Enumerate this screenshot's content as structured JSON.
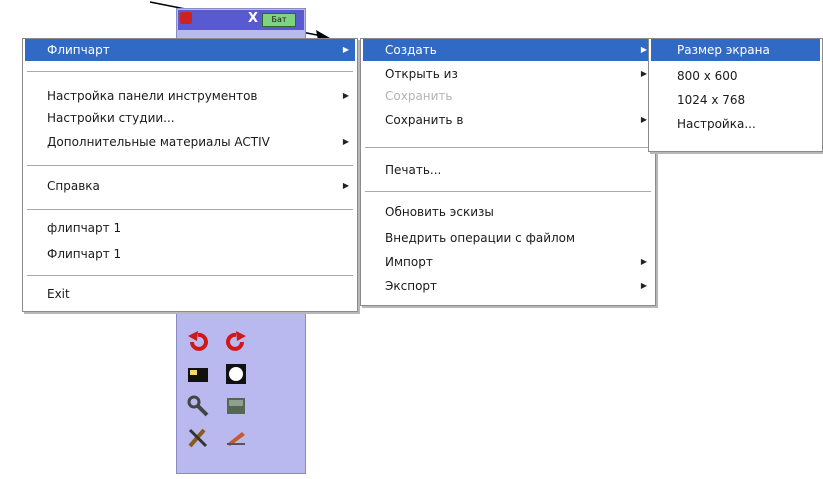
{
  "toolbar": {
    "close_label": "X",
    "mini_label": "Бат",
    "tools": [
      {
        "icon": "undo-icon"
      },
      {
        "icon": "redo-icon"
      },
      {
        "icon": "camera-icon"
      },
      {
        "icon": "spotlight-icon"
      },
      {
        "icon": "wrench-icon"
      },
      {
        "icon": "screen-shade-icon"
      },
      {
        "icon": "tools-icon"
      },
      {
        "icon": "pen-icon"
      }
    ]
  },
  "main_menu": {
    "items": [
      {
        "label": "Флипчарт"
      },
      {
        "label": "Настройка панели инструментов"
      },
      {
        "label": "Настройки студии..."
      },
      {
        "label": "Дополнительные материалы ACTIV"
      },
      {
        "label": "Справка"
      },
      {
        "label": "флипчарт 1"
      },
      {
        "label": "Флипчарт 1"
      },
      {
        "label": "Exit"
      }
    ]
  },
  "flipchart_menu": {
    "items": [
      {
        "label": "Создать"
      },
      {
        "label": "Открыть из"
      },
      {
        "label": "Сохранить"
      },
      {
        "label": "Сохранить в"
      },
      {
        "label": "Печать..."
      },
      {
        "label": "Обновить эскизы"
      },
      {
        "label": "Внедрить операции с файлом"
      },
      {
        "label": "Импорт"
      },
      {
        "label": "Экспорт"
      }
    ]
  },
  "create_menu": {
    "items": [
      {
        "label": "Размер экрана"
      },
      {
        "label": "800 x 600"
      },
      {
        "label": "1024 x 768"
      },
      {
        "label": "Настройка..."
      }
    ]
  },
  "colors": {
    "highlight": "#316ac5",
    "toolbar_bg": "#b9b9ef",
    "disabled": "#b4b4b4"
  }
}
